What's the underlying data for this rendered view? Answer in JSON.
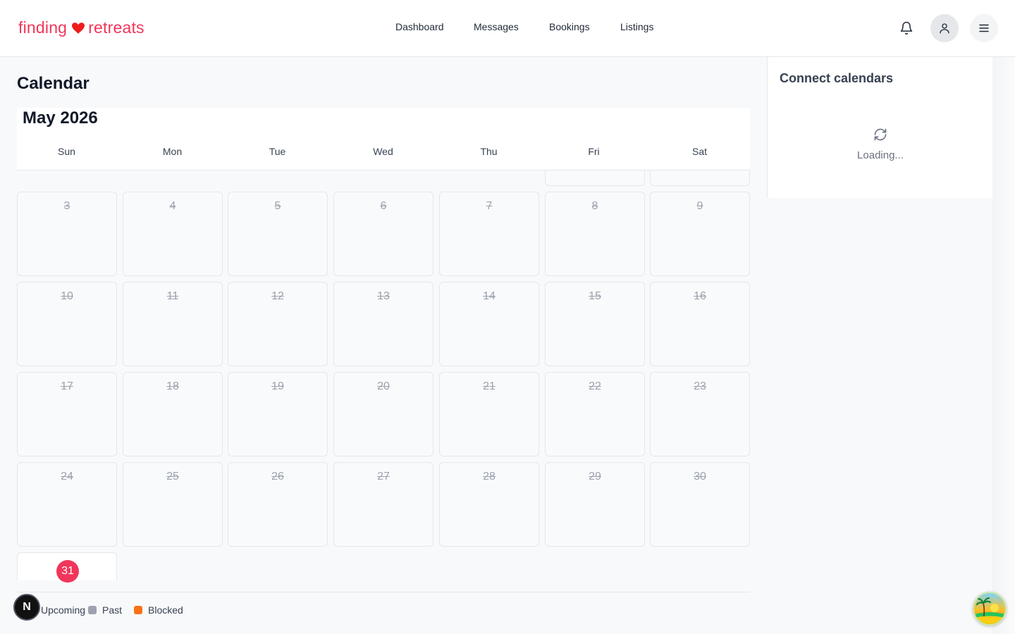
{
  "brand": {
    "name_part1": "finding",
    "name_part2": "retreats",
    "color": "#f0365a",
    "heart_icon": "heart-icon"
  },
  "nav": {
    "items": [
      {
        "label": "Dashboard"
      },
      {
        "label": "Messages"
      },
      {
        "label": "Bookings"
      },
      {
        "label": "Listings"
      }
    ]
  },
  "header_icons": {
    "notifications": "bell-icon",
    "profile": "user-icon",
    "menu": "hamburger-menu-icon"
  },
  "page": {
    "title": "Calendar"
  },
  "calendar": {
    "month_label": "May 2026",
    "weekdays": [
      "Sun",
      "Mon",
      "Tue",
      "Wed",
      "Thu",
      "Fri",
      "Sat"
    ],
    "weeks": [
      [
        "3",
        "4",
        "5",
        "6",
        "7",
        "8",
        "9"
      ],
      [
        "10",
        "11",
        "12",
        "13",
        "14",
        "15",
        "16"
      ],
      [
        "17",
        "18",
        "19",
        "20",
        "21",
        "22",
        "23"
      ],
      [
        "24",
        "25",
        "26",
        "27",
        "28",
        "29",
        "30"
      ]
    ],
    "today": "31",
    "today_color": "#f0365a",
    "past_days_struck_through": true
  },
  "legend": {
    "items": [
      {
        "label": "Upcoming",
        "color": "#f0365a"
      },
      {
        "label": "Past",
        "color": "#9ca3af"
      },
      {
        "label": "Blocked",
        "color": "#f97316"
      }
    ]
  },
  "side_panel": {
    "title": "Connect calendars",
    "loading_text": "Loading...",
    "icon": "refresh-icon"
  },
  "overlays": {
    "dev_badge_letter": "N",
    "dev_badge_icon": "nextjs-icon",
    "avatar_icon": "beach-avatar-icon"
  }
}
